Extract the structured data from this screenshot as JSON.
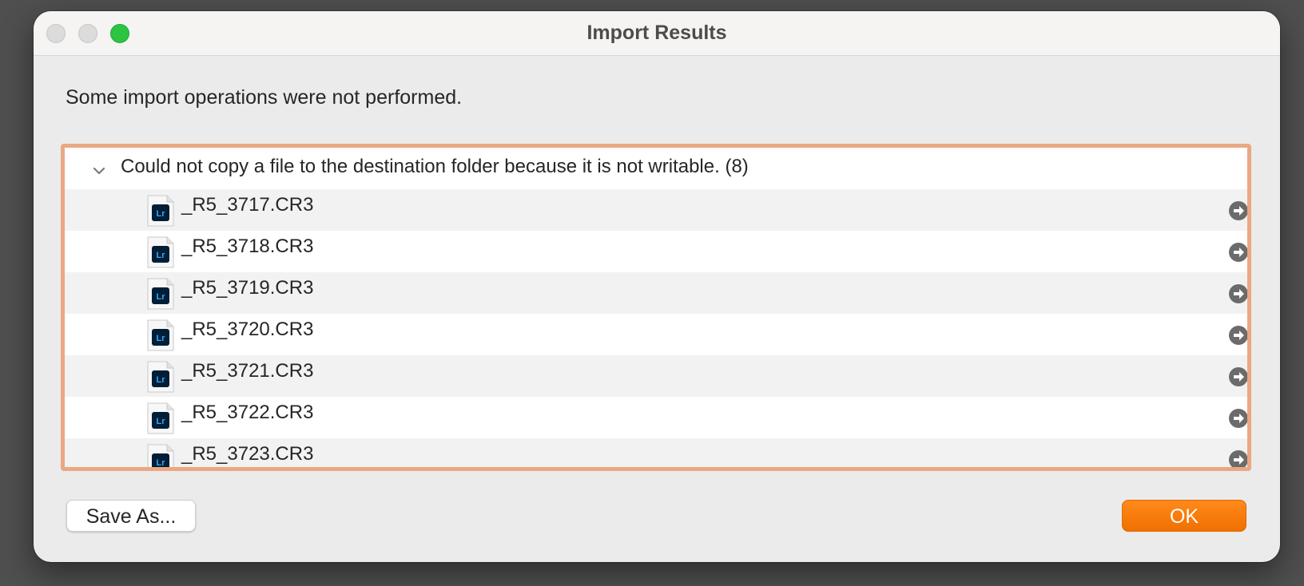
{
  "window": {
    "title": "Import Results"
  },
  "message": "Some import operations were not performed.",
  "group": {
    "label": "Could not copy a file to the destination folder because it is not writable. (8)",
    "expanded": true
  },
  "files": [
    {
      "name": "_R5_3717.CR3",
      "icon": "lightroom-file-icon"
    },
    {
      "name": "_R5_3718.CR3",
      "icon": "lightroom-file-icon"
    },
    {
      "name": "_R5_3719.CR3",
      "icon": "lightroom-file-icon"
    },
    {
      "name": "_R5_3720.CR3",
      "icon": "lightroom-file-icon"
    },
    {
      "name": "_R5_3721.CR3",
      "icon": "lightroom-file-icon"
    },
    {
      "name": "_R5_3722.CR3",
      "icon": "lightroom-file-icon"
    },
    {
      "name": "_R5_3723.CR3",
      "icon": "lightroom-file-icon"
    }
  ],
  "buttons": {
    "save_as": "Save As...",
    "ok": "OK"
  },
  "colors": {
    "accent": "#f57600",
    "list_border": "#eaa882",
    "zoom_button": "#2cc542"
  }
}
